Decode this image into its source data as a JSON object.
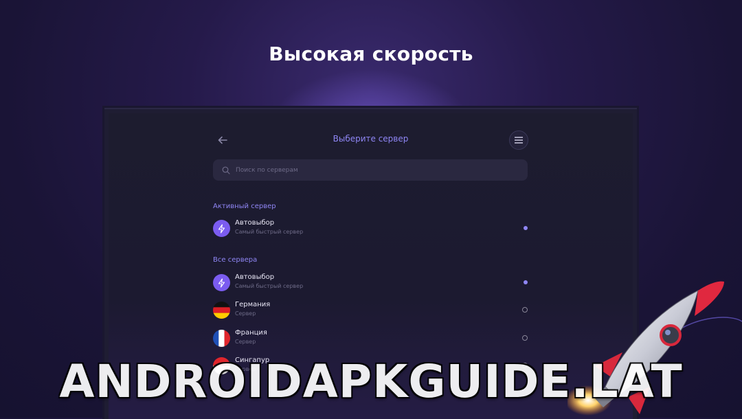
{
  "promo": {
    "headline": "Высокая скорость"
  },
  "app": {
    "title": "Выберите сервер",
    "search": {
      "placeholder": "Поиск по серверам",
      "value": ""
    },
    "active_section": {
      "label": "Активный сервер",
      "item": {
        "name": "Автовыбор",
        "subtitle": "Самый быстрый сервер",
        "icon": "bolt-icon",
        "selected": true
      }
    },
    "all_section": {
      "label": "Все сервера",
      "items": [
        {
          "name": "Автовыбор",
          "subtitle": "Самый быстрый сервер",
          "icon": "bolt-icon",
          "selected": true
        },
        {
          "name": "Германия",
          "subtitle": "Сервер",
          "icon": "germany-flag-icon",
          "selected": false
        },
        {
          "name": "Франция",
          "subtitle": "Сервер",
          "icon": "france-flag-icon",
          "selected": false
        },
        {
          "name": "Сингапур",
          "subtitle": "Сервер",
          "icon": "singapore-flag-icon",
          "selected": false
        }
      ]
    }
  },
  "watermark": {
    "text": "ANDROIDAPKGUIDE.LAT"
  },
  "colors": {
    "accent": "#8f86f5",
    "bolt_bg": "#7b5cf0",
    "background": "#1f1d33"
  }
}
